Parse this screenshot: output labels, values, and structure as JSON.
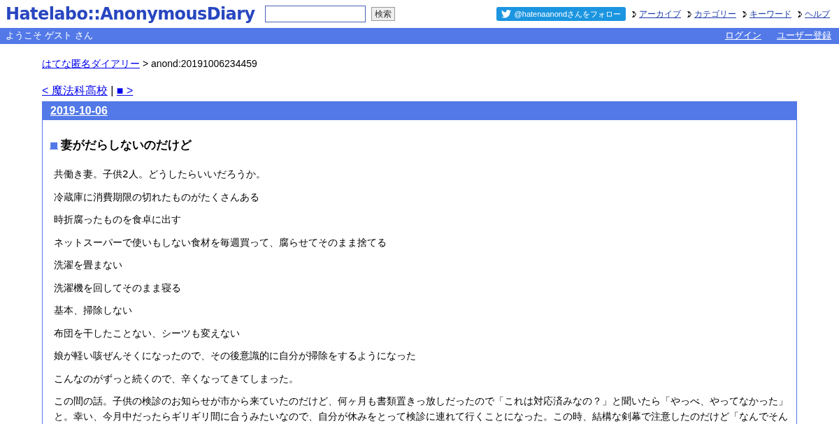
{
  "header": {
    "logo": "Hatelabo::AnonymousDiary",
    "search_button": "検索",
    "twitter_follow": "@hatenaanondさんをフォロー",
    "nav_links": [
      "アーカイブ",
      "カテゴリー",
      "キーワード",
      "ヘルプ"
    ]
  },
  "user_bar": {
    "welcome": "ようこそ ゲスト さん",
    "links": [
      "ログイン",
      "ユーザー登録"
    ]
  },
  "breadcrumb": {
    "link": "はてな匿名ダイアリー",
    "current": "> anond:20191006234459"
  },
  "pager": {
    "prev": "< 魔法科高校",
    "separator": "|",
    "next": "■ >"
  },
  "day": {
    "date": "2019-10-06",
    "entry": {
      "marker": "■",
      "title": "妻がだらしないのだけど",
      "paragraphs": [
        "共働き妻。子供2人。どうしたらいいだろうか。",
        "冷蔵庫に消費期限の切れたものがたくさんある",
        "時折腐ったものを食卓に出す",
        "ネットスーパーで使いもしない食材を毎週買って、腐らせてそのまま捨てる",
        "洗濯を畳まない",
        "洗濯機を回してそのまま寝る",
        "基本、掃除しない",
        "布団を干したことない、シーツも変えない",
        "娘が軽い咳ぜんそくになったので、その後意識的に自分が掃除をするようになった",
        "こんなのがずっと続くので、辛くなってきてしまった。",
        "この間の話。子供の検診のお知らせが市から来ていたのだけど、何ヶ月も書類置きっ放しだったので「これは対応済みなの？」と聞いたら「やっべ、やってなかった」と。幸い、今月中だったらギリギリ間に合うみたいなので、自分が休みをとって検診に連れて行くことになった。この時、結構な剣幕で注意したのだけど「なんでそん"
      ]
    }
  }
}
